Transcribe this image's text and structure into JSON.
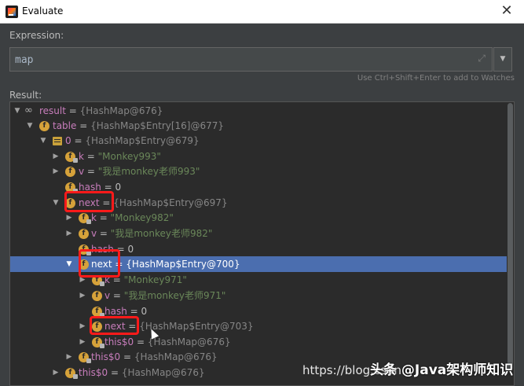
{
  "window": {
    "title": "Evaluate"
  },
  "expression": {
    "label": "Expression:",
    "value": "map",
    "hint": "Use Ctrl+Shift+Enter to add to Watches"
  },
  "result": {
    "label": "Result:",
    "rows": [
      {
        "toggle": "▼",
        "icon": "watch",
        "name": "result",
        "eq": " = ",
        "value": "{HashMap@676}"
      },
      {
        "toggle": "▼",
        "icon": "field",
        "name": "table",
        "eq": " = ",
        "value": "{HashMap$Entry[16]@677}"
      },
      {
        "toggle": "▼",
        "icon": "array",
        "name": "0",
        "eq": " = ",
        "value": "{HashMap$Entry@679}"
      },
      {
        "toggle": "▶",
        "icon": "field",
        "name": "k",
        "eq": " = ",
        "value": "\"Monkey993\""
      },
      {
        "toggle": "▶",
        "icon": "field",
        "name": "v",
        "eq": " = ",
        "value": "\"我是monkey老师993\""
      },
      {
        "toggle": "",
        "icon": "field",
        "name": "hash",
        "eq": " = ",
        "value": "0"
      },
      {
        "toggle": "▼",
        "icon": "field",
        "name": "next",
        "eq": " = ",
        "value": "{HashMap$Entry@697}"
      },
      {
        "toggle": "▶",
        "icon": "field",
        "name": "k",
        "eq": " = ",
        "value": "\"Monkey982\""
      },
      {
        "toggle": "▶",
        "icon": "field",
        "name": "v",
        "eq": " = ",
        "value": "\"我是monkey老师982\""
      },
      {
        "toggle": "",
        "icon": "field",
        "name": "hash",
        "eq": " = ",
        "value": "0"
      },
      {
        "toggle": "▼",
        "icon": "field",
        "name": "next",
        "eq": " = ",
        "value": "{HashMap$Entry@700}"
      },
      {
        "toggle": "▶",
        "icon": "field",
        "name": "k",
        "eq": " = ",
        "value": "\"Monkey971\""
      },
      {
        "toggle": "▶",
        "icon": "field",
        "name": "v",
        "eq": " = ",
        "value": "\"我是monkey老师971\""
      },
      {
        "toggle": "",
        "icon": "field",
        "name": "hash",
        "eq": " = ",
        "value": "0"
      },
      {
        "toggle": "▶",
        "icon": "field",
        "name": "next",
        "eq": " = ",
        "value": "{HashMap$Entry@703}"
      },
      {
        "toggle": "▶",
        "icon": "field",
        "name": "this$0",
        "eq": " = ",
        "value": "{HashMap@676}"
      },
      {
        "toggle": "▶",
        "icon": "field",
        "name": "this$0",
        "eq": " = ",
        "value": "{HashMap@676}"
      },
      {
        "toggle": "▶",
        "icon": "field",
        "name": "this$0",
        "eq": " = ",
        "value": "{HashMap@676}"
      }
    ]
  },
  "watermark": {
    "url": "https://blog.csdn.",
    "brand": "头条 @Java架构师知识"
  },
  "colors": {
    "selection": "#4b6eaf",
    "highlight": "#ff1a1a",
    "field_icon": "#d6a23a",
    "string_value": "#6a8759",
    "field_name": "#c77dbb"
  }
}
